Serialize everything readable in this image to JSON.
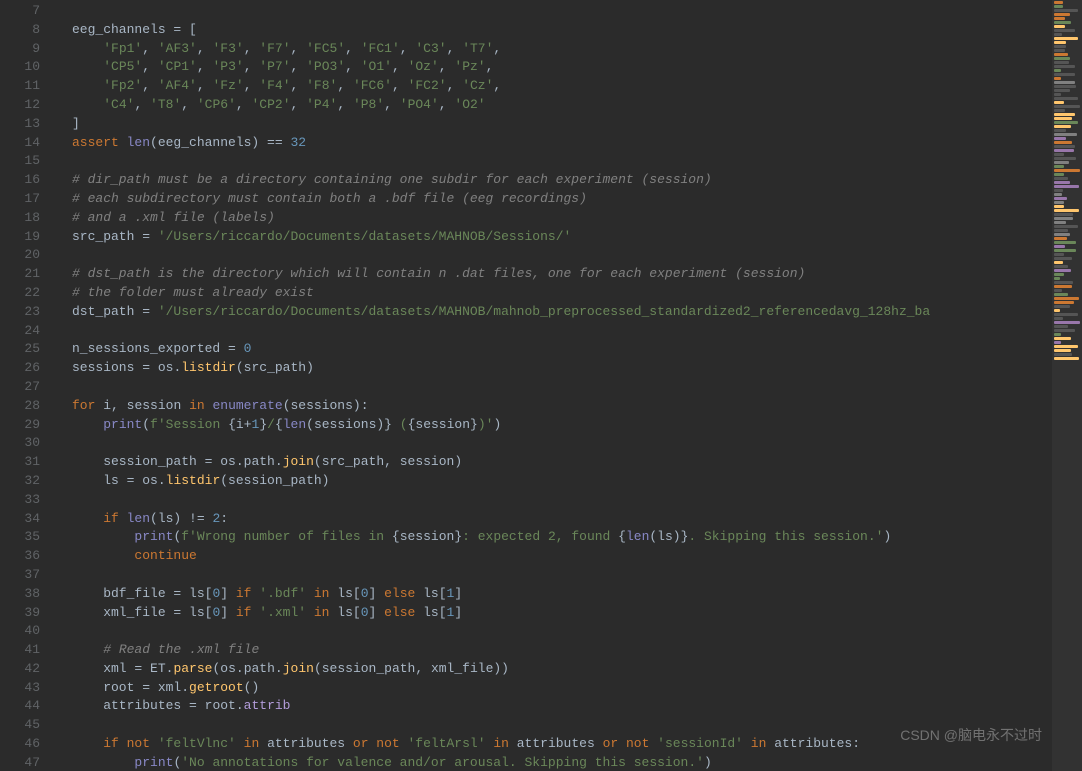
{
  "watermark": "CSDN @脑电永不过时",
  "startLine": 7,
  "lines": [
    {
      "n": 7,
      "tokens": []
    },
    {
      "n": 8,
      "tokens": [
        {
          "t": "eeg_channels ",
          "c": "ident"
        },
        {
          "t": "= [",
          "c": "op"
        }
      ]
    },
    {
      "n": 9,
      "tokens": [
        {
          "t": "    ",
          "c": "op"
        },
        {
          "t": "'Fp1'",
          "c": "str"
        },
        {
          "t": ", ",
          "c": "op"
        },
        {
          "t": "'AF3'",
          "c": "str"
        },
        {
          "t": ", ",
          "c": "op"
        },
        {
          "t": "'F3'",
          "c": "str"
        },
        {
          "t": ", ",
          "c": "op"
        },
        {
          "t": "'F7'",
          "c": "str"
        },
        {
          "t": ", ",
          "c": "op"
        },
        {
          "t": "'FC5'",
          "c": "str"
        },
        {
          "t": ", ",
          "c": "op"
        },
        {
          "t": "'FC1'",
          "c": "str"
        },
        {
          "t": ", ",
          "c": "op"
        },
        {
          "t": "'C3'",
          "c": "str"
        },
        {
          "t": ", ",
          "c": "op"
        },
        {
          "t": "'T7'",
          "c": "str"
        },
        {
          "t": ",",
          "c": "op"
        }
      ]
    },
    {
      "n": 10,
      "tokens": [
        {
          "t": "    ",
          "c": "op"
        },
        {
          "t": "'CP5'",
          "c": "str"
        },
        {
          "t": ", ",
          "c": "op"
        },
        {
          "t": "'CP1'",
          "c": "str"
        },
        {
          "t": ", ",
          "c": "op"
        },
        {
          "t": "'P3'",
          "c": "str"
        },
        {
          "t": ", ",
          "c": "op"
        },
        {
          "t": "'P7'",
          "c": "str"
        },
        {
          "t": ", ",
          "c": "op"
        },
        {
          "t": "'PO3'",
          "c": "str"
        },
        {
          "t": ", ",
          "c": "op"
        },
        {
          "t": "'O1'",
          "c": "str"
        },
        {
          "t": ", ",
          "c": "op"
        },
        {
          "t": "'Oz'",
          "c": "str"
        },
        {
          "t": ", ",
          "c": "op"
        },
        {
          "t": "'Pz'",
          "c": "str"
        },
        {
          "t": ",",
          "c": "op"
        }
      ]
    },
    {
      "n": 11,
      "tokens": [
        {
          "t": "    ",
          "c": "op"
        },
        {
          "t": "'Fp2'",
          "c": "str"
        },
        {
          "t": ", ",
          "c": "op"
        },
        {
          "t": "'AF4'",
          "c": "str"
        },
        {
          "t": ", ",
          "c": "op"
        },
        {
          "t": "'Fz'",
          "c": "str"
        },
        {
          "t": ", ",
          "c": "op"
        },
        {
          "t": "'F4'",
          "c": "str"
        },
        {
          "t": ", ",
          "c": "op"
        },
        {
          "t": "'F8'",
          "c": "str"
        },
        {
          "t": ", ",
          "c": "op"
        },
        {
          "t": "'FC6'",
          "c": "str"
        },
        {
          "t": ", ",
          "c": "op"
        },
        {
          "t": "'FC2'",
          "c": "str"
        },
        {
          "t": ", ",
          "c": "op"
        },
        {
          "t": "'Cz'",
          "c": "str"
        },
        {
          "t": ",",
          "c": "op"
        }
      ]
    },
    {
      "n": 12,
      "tokens": [
        {
          "t": "    ",
          "c": "op"
        },
        {
          "t": "'C4'",
          "c": "str"
        },
        {
          "t": ", ",
          "c": "op"
        },
        {
          "t": "'T8'",
          "c": "str"
        },
        {
          "t": ", ",
          "c": "op"
        },
        {
          "t": "'CP6'",
          "c": "str"
        },
        {
          "t": ", ",
          "c": "op"
        },
        {
          "t": "'CP2'",
          "c": "str"
        },
        {
          "t": ", ",
          "c": "op"
        },
        {
          "t": "'P4'",
          "c": "str"
        },
        {
          "t": ", ",
          "c": "op"
        },
        {
          "t": "'P8'",
          "c": "str"
        },
        {
          "t": ", ",
          "c": "op"
        },
        {
          "t": "'PO4'",
          "c": "str"
        },
        {
          "t": ", ",
          "c": "op"
        },
        {
          "t": "'O2'",
          "c": "str"
        }
      ]
    },
    {
      "n": 13,
      "tokens": [
        {
          "t": "]",
          "c": "op"
        }
      ]
    },
    {
      "n": 14,
      "tokens": [
        {
          "t": "assert ",
          "c": "kw"
        },
        {
          "t": "len",
          "c": "builtin"
        },
        {
          "t": "(eeg_channels) ",
          "c": "op"
        },
        {
          "t": "== ",
          "c": "op"
        },
        {
          "t": "32",
          "c": "num"
        }
      ]
    },
    {
      "n": 15,
      "tokens": []
    },
    {
      "n": 16,
      "tokens": [
        {
          "t": "# dir_path must be a directory containing one subdir for each experiment (session)",
          "c": "cmt"
        }
      ]
    },
    {
      "n": 17,
      "tokens": [
        {
          "t": "# each subdirectory must contain both a .bdf file (eeg recordings)",
          "c": "cmt"
        }
      ]
    },
    {
      "n": 18,
      "tokens": [
        {
          "t": "# and a .xml file (labels)",
          "c": "cmt"
        }
      ]
    },
    {
      "n": 19,
      "tokens": [
        {
          "t": "src_path ",
          "c": "ident"
        },
        {
          "t": "= ",
          "c": "op"
        },
        {
          "t": "'/Users/riccardo/Documents/datasets/MAHNOB/Sessions/'",
          "c": "str"
        }
      ]
    },
    {
      "n": 20,
      "tokens": []
    },
    {
      "n": 21,
      "tokens": [
        {
          "t": "# dst_path is the directory which will contain n .dat files, one for each experiment (session)",
          "c": "cmt"
        }
      ]
    },
    {
      "n": 22,
      "tokens": [
        {
          "t": "# the folder must already exist",
          "c": "cmt"
        }
      ]
    },
    {
      "n": 23,
      "tokens": [
        {
          "t": "dst_path ",
          "c": "ident"
        },
        {
          "t": "= ",
          "c": "op"
        },
        {
          "t": "'/Users/riccardo/Documents/datasets/MAHNOB/mahnob_preprocessed_standardized2_referencedavg_128hz_ba",
          "c": "str"
        }
      ]
    },
    {
      "n": 24,
      "tokens": []
    },
    {
      "n": 25,
      "tokens": [
        {
          "t": "n_sessions_exported ",
          "c": "ident"
        },
        {
          "t": "= ",
          "c": "op"
        },
        {
          "t": "0",
          "c": "num"
        }
      ]
    },
    {
      "n": 26,
      "tokens": [
        {
          "t": "sessions ",
          "c": "ident"
        },
        {
          "t": "= ",
          "c": "op"
        },
        {
          "t": "os",
          "c": "ident"
        },
        {
          "t": ".",
          "c": "op"
        },
        {
          "t": "listdir",
          "c": "fn"
        },
        {
          "t": "(src_path)",
          "c": "op"
        }
      ]
    },
    {
      "n": 27,
      "tokens": []
    },
    {
      "n": 28,
      "tokens": [
        {
          "t": "for ",
          "c": "kw"
        },
        {
          "t": "i",
          "c": "ident"
        },
        {
          "t": ", ",
          "c": "op"
        },
        {
          "t": "session ",
          "c": "ident"
        },
        {
          "t": "in ",
          "c": "kw"
        },
        {
          "t": "enumerate",
          "c": "builtin"
        },
        {
          "t": "(sessions):",
          "c": "op"
        }
      ]
    },
    {
      "n": 29,
      "tokens": [
        {
          "t": "    ",
          "c": "op"
        },
        {
          "t": "print",
          "c": "builtin"
        },
        {
          "t": "(",
          "c": "op"
        },
        {
          "t": "f'Session ",
          "c": "str"
        },
        {
          "t": "{",
          "c": "op"
        },
        {
          "t": "i",
          "c": "ident"
        },
        {
          "t": "+",
          "c": "op"
        },
        {
          "t": "1",
          "c": "num"
        },
        {
          "t": "}",
          "c": "op"
        },
        {
          "t": "/",
          "c": "str"
        },
        {
          "t": "{",
          "c": "op"
        },
        {
          "t": "len",
          "c": "builtin"
        },
        {
          "t": "(sessions)",
          "c": "op"
        },
        {
          "t": "}",
          "c": "op"
        },
        {
          "t": " (",
          "c": "str"
        },
        {
          "t": "{",
          "c": "op"
        },
        {
          "t": "session",
          "c": "ident"
        },
        {
          "t": "}",
          "c": "op"
        },
        {
          "t": ")'",
          "c": "str"
        },
        {
          "t": ")",
          "c": "op"
        }
      ]
    },
    {
      "n": 30,
      "tokens": []
    },
    {
      "n": 31,
      "tokens": [
        {
          "t": "    session_path ",
          "c": "ident"
        },
        {
          "t": "= ",
          "c": "op"
        },
        {
          "t": "os",
          "c": "ident"
        },
        {
          "t": ".",
          "c": "op"
        },
        {
          "t": "path",
          "c": "ident"
        },
        {
          "t": ".",
          "c": "op"
        },
        {
          "t": "join",
          "c": "fn"
        },
        {
          "t": "(src_path, session)",
          "c": "op"
        }
      ]
    },
    {
      "n": 32,
      "tokens": [
        {
          "t": "    ls ",
          "c": "ident"
        },
        {
          "t": "= ",
          "c": "op"
        },
        {
          "t": "os",
          "c": "ident"
        },
        {
          "t": ".",
          "c": "op"
        },
        {
          "t": "listdir",
          "c": "fn"
        },
        {
          "t": "(session_path)",
          "c": "op"
        }
      ]
    },
    {
      "n": 33,
      "tokens": []
    },
    {
      "n": 34,
      "tokens": [
        {
          "t": "    ",
          "c": "op"
        },
        {
          "t": "if ",
          "c": "kw"
        },
        {
          "t": "len",
          "c": "builtin"
        },
        {
          "t": "(ls) ",
          "c": "op"
        },
        {
          "t": "!= ",
          "c": "op"
        },
        {
          "t": "2",
          "c": "num"
        },
        {
          "t": ":",
          "c": "op"
        }
      ]
    },
    {
      "n": 35,
      "tokens": [
        {
          "t": "        ",
          "c": "op"
        },
        {
          "t": "print",
          "c": "builtin"
        },
        {
          "t": "(",
          "c": "op"
        },
        {
          "t": "f'Wrong number of files in ",
          "c": "str"
        },
        {
          "t": "{",
          "c": "op"
        },
        {
          "t": "session",
          "c": "ident"
        },
        {
          "t": "}",
          "c": "op"
        },
        {
          "t": ": expected 2, found ",
          "c": "str"
        },
        {
          "t": "{",
          "c": "op"
        },
        {
          "t": "len",
          "c": "builtin"
        },
        {
          "t": "(ls)",
          "c": "op"
        },
        {
          "t": "}",
          "c": "op"
        },
        {
          "t": ". Skipping this session.'",
          "c": "str"
        },
        {
          "t": ")",
          "c": "op"
        }
      ]
    },
    {
      "n": 36,
      "tokens": [
        {
          "t": "        ",
          "c": "op"
        },
        {
          "t": "continue",
          "c": "kw"
        }
      ]
    },
    {
      "n": 37,
      "tokens": []
    },
    {
      "n": 38,
      "tokens": [
        {
          "t": "    bdf_file ",
          "c": "ident"
        },
        {
          "t": "= ",
          "c": "op"
        },
        {
          "t": "ls[",
          "c": "op"
        },
        {
          "t": "0",
          "c": "num"
        },
        {
          "t": "] ",
          "c": "op"
        },
        {
          "t": "if ",
          "c": "kw"
        },
        {
          "t": "'.bdf' ",
          "c": "str"
        },
        {
          "t": "in ",
          "c": "kw"
        },
        {
          "t": "ls[",
          "c": "op"
        },
        {
          "t": "0",
          "c": "num"
        },
        {
          "t": "] ",
          "c": "op"
        },
        {
          "t": "else ",
          "c": "kw"
        },
        {
          "t": "ls[",
          "c": "op"
        },
        {
          "t": "1",
          "c": "num"
        },
        {
          "t": "]",
          "c": "op"
        }
      ]
    },
    {
      "n": 39,
      "tokens": [
        {
          "t": "    xml_file ",
          "c": "ident"
        },
        {
          "t": "= ",
          "c": "op"
        },
        {
          "t": "ls[",
          "c": "op"
        },
        {
          "t": "0",
          "c": "num"
        },
        {
          "t": "] ",
          "c": "op"
        },
        {
          "t": "if ",
          "c": "kw"
        },
        {
          "t": "'.xml' ",
          "c": "str"
        },
        {
          "t": "in ",
          "c": "kw"
        },
        {
          "t": "ls[",
          "c": "op"
        },
        {
          "t": "0",
          "c": "num"
        },
        {
          "t": "] ",
          "c": "op"
        },
        {
          "t": "else ",
          "c": "kw"
        },
        {
          "t": "ls[",
          "c": "op"
        },
        {
          "t": "1",
          "c": "num"
        },
        {
          "t": "]",
          "c": "op"
        }
      ]
    },
    {
      "n": 40,
      "tokens": []
    },
    {
      "n": 41,
      "tokens": [
        {
          "t": "    ",
          "c": "op"
        },
        {
          "t": "# Read the .xml file",
          "c": "cmt"
        }
      ]
    },
    {
      "n": 42,
      "tokens": [
        {
          "t": "    xml ",
          "c": "ident"
        },
        {
          "t": "= ",
          "c": "op"
        },
        {
          "t": "ET",
          "c": "ident"
        },
        {
          "t": ".",
          "c": "op"
        },
        {
          "t": "parse",
          "c": "fn"
        },
        {
          "t": "(os",
          "c": "op"
        },
        {
          "t": ".",
          "c": "op"
        },
        {
          "t": "path",
          "c": "ident"
        },
        {
          "t": ".",
          "c": "op"
        },
        {
          "t": "join",
          "c": "fn"
        },
        {
          "t": "(session_path, xml_file))",
          "c": "op"
        }
      ]
    },
    {
      "n": 43,
      "tokens": [
        {
          "t": "    root ",
          "c": "ident"
        },
        {
          "t": "= ",
          "c": "op"
        },
        {
          "t": "xml",
          "c": "ident"
        },
        {
          "t": ".",
          "c": "op"
        },
        {
          "t": "getroot",
          "c": "fn"
        },
        {
          "t": "()",
          "c": "op"
        }
      ]
    },
    {
      "n": 44,
      "tokens": [
        {
          "t": "    attributes ",
          "c": "ident"
        },
        {
          "t": "= ",
          "c": "op"
        },
        {
          "t": "root",
          "c": "ident"
        },
        {
          "t": ".",
          "c": "op"
        },
        {
          "t": "attrib",
          "c": "prop"
        }
      ]
    },
    {
      "n": 45,
      "tokens": []
    },
    {
      "n": 46,
      "tokens": [
        {
          "t": "    ",
          "c": "op"
        },
        {
          "t": "if not ",
          "c": "kw"
        },
        {
          "t": "'feltVlnc' ",
          "c": "str"
        },
        {
          "t": "in ",
          "c": "kw"
        },
        {
          "t": "attributes ",
          "c": "ident"
        },
        {
          "t": "or not ",
          "c": "kw"
        },
        {
          "t": "'feltArsl' ",
          "c": "str"
        },
        {
          "t": "in ",
          "c": "kw"
        },
        {
          "t": "attributes ",
          "c": "ident"
        },
        {
          "t": "or not ",
          "c": "kw"
        },
        {
          "t": "'sessionId' ",
          "c": "str"
        },
        {
          "t": "in ",
          "c": "kw"
        },
        {
          "t": "attributes:",
          "c": "ident"
        }
      ]
    },
    {
      "n": 47,
      "tokens": [
        {
          "t": "        ",
          "c": "op"
        },
        {
          "t": "print",
          "c": "builtin"
        },
        {
          "t": "(",
          "c": "op"
        },
        {
          "t": "'No annotations for valence and/or arousal. Skipping this session.'",
          "c": "str"
        },
        {
          "t": ")",
          "c": "op"
        }
      ]
    }
  ],
  "minimapLines": 90
}
